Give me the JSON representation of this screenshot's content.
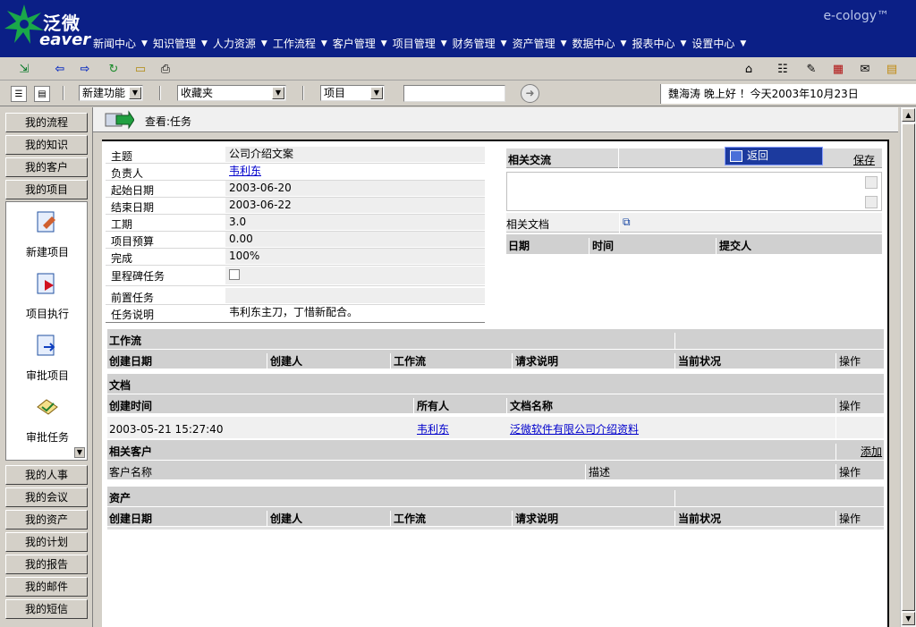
{
  "header": {
    "logo_cn": "泛微",
    "logo_en": "eaver",
    "brand": "e-cology™",
    "nav": [
      "新闻中心",
      "知识管理",
      "人力资源",
      "工作流程",
      "客户管理",
      "项目管理",
      "财务管理",
      "资产管理",
      "数据中心",
      "报表中心",
      "设置中心"
    ]
  },
  "toolbar2": {
    "select1": "新建功能",
    "select2": "收藏夹",
    "select3": "项目",
    "search_value": "",
    "greeting": "魏海涛 晚上好 ！今天2003年10月23日"
  },
  "sidebar": {
    "top_buttons": [
      "我的流程",
      "我的知识",
      "我的客户",
      "我的项目"
    ],
    "apps": [
      "新建项目",
      "项目执行",
      "审批项目",
      "审批任务"
    ],
    "bottom_buttons": [
      "我的人事",
      "我的会议",
      "我的资产",
      "我的计划",
      "我的报告",
      "我的邮件",
      "我的短信"
    ]
  },
  "crumb": "查看:任务",
  "task": {
    "rows": [
      {
        "label": "主题",
        "value": "公司介绍文案"
      },
      {
        "label": "负责人",
        "value": "韦利东"
      },
      {
        "label": "起始日期",
        "value": "2003-06-20"
      },
      {
        "label": "结束日期",
        "value": "2003-06-22"
      },
      {
        "label": "工期",
        "value": "3.0"
      },
      {
        "label": "项目预算",
        "value": "0.00"
      },
      {
        "label": "完成",
        "value": "100%"
      },
      {
        "label": "里程碑任务",
        "value": ""
      },
      {
        "label": "前置任务",
        "value": ""
      },
      {
        "label": "任务说明",
        "value": "韦利东主刀，丁惜新配合。"
      }
    ]
  },
  "right": {
    "title": "相关交流",
    "back": "返回",
    "save": "保存",
    "docs_label": "相关文档",
    "cols": [
      "日期",
      "时间",
      "提交人"
    ]
  },
  "workflow": {
    "title": "工作流",
    "cols": [
      "创建日期",
      "创建人",
      "工作流",
      "请求说明",
      "当前状况",
      "操作"
    ]
  },
  "documents": {
    "title": "文档",
    "cols": [
      "创建时间",
      "所有人",
      "文档名称",
      "操作"
    ],
    "row": {
      "time": "2003-05-21 15:27:40",
      "owner": "韦利东",
      "name": "泛微软件有限公司介绍资料"
    }
  },
  "customers": {
    "title": "相关客户",
    "add": "添加",
    "cols": [
      "客户名称",
      "描述",
      "操作"
    ]
  },
  "assets": {
    "title": "资产",
    "cols": [
      "创建日期",
      "创建人",
      "工作流",
      "请求说明",
      "当前状况",
      "操作"
    ]
  }
}
